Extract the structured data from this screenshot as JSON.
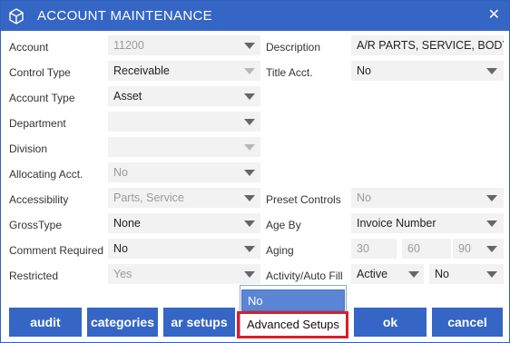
{
  "window": {
    "title": "ACCOUNT MAINTENANCE",
    "close_glyph": "✕",
    "title_icon": "cube-icon",
    "accent": "#3566c5"
  },
  "left": {
    "account": {
      "label": "Account",
      "value": "11200"
    },
    "control_type": {
      "label": "Control Type",
      "value": "Receivable"
    },
    "account_type": {
      "label": "Account Type",
      "value": "Asset"
    },
    "department": {
      "label": "Department",
      "value": ""
    },
    "division": {
      "label": "Division",
      "value": ""
    },
    "allocating": {
      "label": "Allocating Acct.",
      "value": "No"
    },
    "accessibility": {
      "label": "Accessibility",
      "value": "Parts, Service"
    },
    "gross_type": {
      "label": "GrossType",
      "value": "None"
    },
    "comment_required": {
      "label": "Comment Required",
      "value": "No"
    },
    "restricted": {
      "label": "Restricted",
      "value": "Yes"
    }
  },
  "right": {
    "description": {
      "label": "Description",
      "value": "A/R PARTS, SERVICE, BODY"
    },
    "title_acct": {
      "label": "Title Acct.",
      "value": "No"
    },
    "preset_controls": {
      "label": "Preset Controls",
      "value": "No"
    },
    "age_by": {
      "label": "Age By",
      "value": "Invoice Number"
    },
    "aging": {
      "label": "Aging",
      "values": [
        "30",
        "60",
        "90"
      ]
    },
    "activity_autofill": {
      "label": "Activity/Auto Fill",
      "activity": "Active",
      "autofill": "No"
    }
  },
  "dropdown": {
    "options": [
      "No",
      "Advanced Setups"
    ],
    "highlight_color": "#d61f2c"
  },
  "buttons": {
    "audit": "audit",
    "categories": "categories",
    "ar_setups": "ar setups",
    "ok": "ok",
    "cancel": "cancel"
  }
}
